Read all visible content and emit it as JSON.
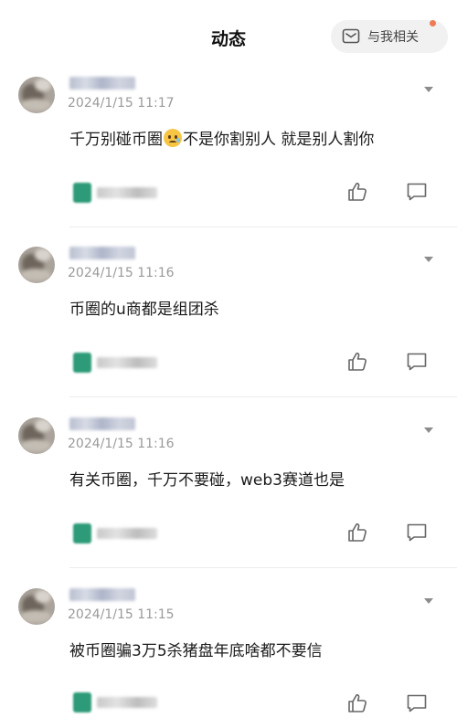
{
  "header": {
    "title": "动态",
    "related_button_label": "与我相关",
    "related_button_icon": "message-icon",
    "notification_dot_color": "#ef7b54"
  },
  "posts": [
    {
      "time": "2024/1/15 11:17",
      "content_before_emoji": "千万别碰币圈",
      "emoji": "pleading-face-emoji",
      "content_after_emoji": "不是你割别人 就是别人割你"
    },
    {
      "time": "2024/1/15 11:16",
      "content": "币圈的u商都是组团杀"
    },
    {
      "time": "2024/1/15 11:16",
      "content": "有关币圈，千万不要碰，web3赛道也是"
    },
    {
      "time": "2024/1/15 11:15",
      "content": "被币圈骗3万5杀猪盘年底啥都不要信"
    }
  ],
  "icons": {
    "more": "chevron-down-icon",
    "like": "thumbs-up-icon",
    "comment": "comment-icon"
  }
}
